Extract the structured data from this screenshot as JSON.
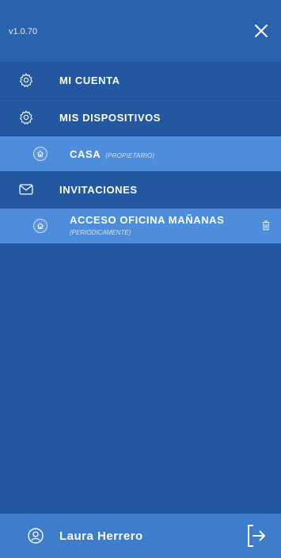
{
  "header": {
    "version": "v1.0.70"
  },
  "menu": {
    "account_label": "MI CUENTA",
    "devices_label": "MIS DISPOSITIVOS",
    "devices": [
      {
        "name": "CASA",
        "tag": "(PROPIETARIO)"
      }
    ],
    "invitations_label": "INVITACIONES",
    "invitations": [
      {
        "name": "ACCESO OFICINA MAÑANAS",
        "tag": "(PERIÓDICAMENTE)"
      }
    ]
  },
  "footer": {
    "user_name": "Laura Herrero"
  },
  "colors": {
    "background": "#2357a0",
    "header": "#2a62ae",
    "highlight_row": "#4d8ddc",
    "footer": "#3e7dcc"
  }
}
